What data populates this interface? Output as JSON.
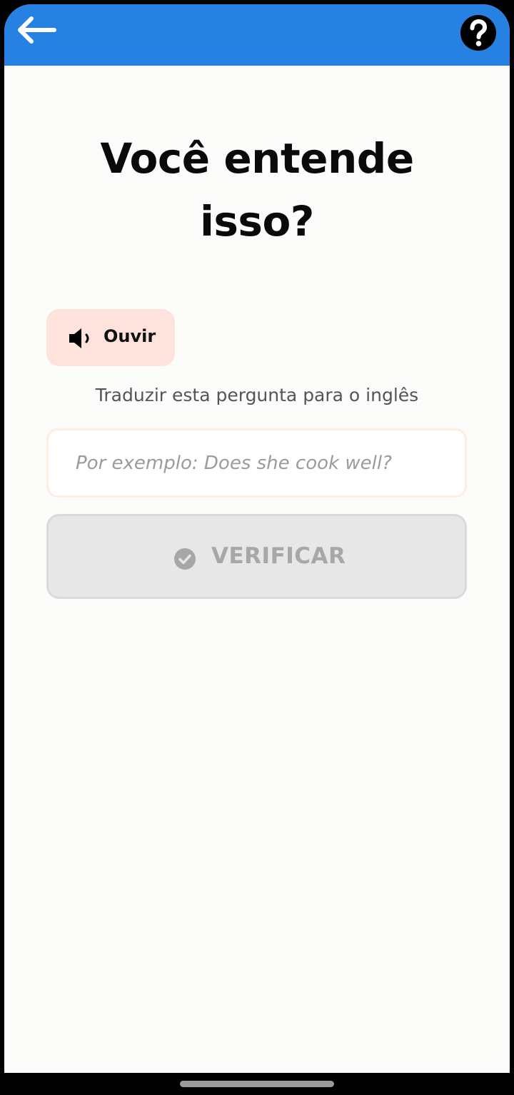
{
  "header": {
    "back_icon": "arrow-left-icon",
    "help_icon": "question-circle-icon",
    "background": "#2781e3"
  },
  "main": {
    "title_line1": "Você entende",
    "title_line2": "isso?",
    "listen_button": {
      "icon": "speaker-icon",
      "label": "Ouvir",
      "background": "#fde3dc"
    },
    "instruction": "Traduzir esta pergunta para o inglês",
    "answer_input": {
      "value": "",
      "placeholder": "Por exemplo: Does she cook well?"
    },
    "verify_button": {
      "icon": "check-circle-icon",
      "label": "VERIFICAR",
      "state": "disabled"
    }
  }
}
